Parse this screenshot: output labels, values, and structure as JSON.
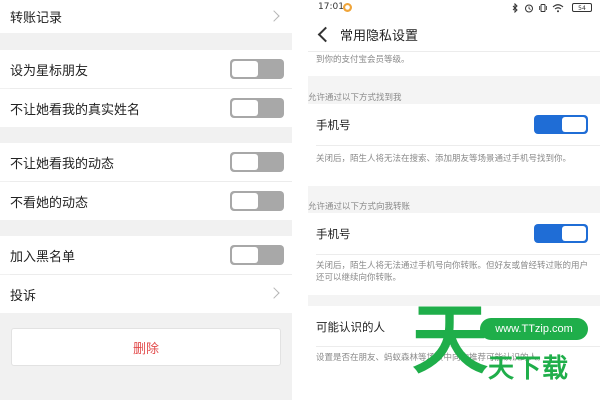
{
  "left": {
    "transfer_record": "转账记录",
    "star_friend": "设为星标朋友",
    "hide_real_name": "不让她看我的真实姓名",
    "hide_my_moments": "不让她看我的动态",
    "hide_her_moments": "不看她的动态",
    "blacklist": "加入黑名单",
    "report": "投诉",
    "delete": "删除",
    "switches": {
      "star_friend": false,
      "hide_real_name": false,
      "hide_my_moments": false,
      "hide_her_moments": false,
      "blacklist": false
    }
  },
  "right": {
    "status": {
      "time": "17:01",
      "battery": "54"
    },
    "title": "常用隐私设置",
    "top_note": "到你的支付宝会员等级。",
    "find_section": "允许通过以下方式找到我",
    "find_phone_label": "手机号",
    "find_phone_note": "关闭后，陌生人将无法在搜索、添加朋友等场景通过手机号找到你。",
    "transfer_section": "允许通过以下方式向我转账",
    "transfer_phone_label": "手机号",
    "transfer_phone_note": "关闭后，陌生人将无法通过手机号向你转账。但好友或曾经转过账的用户还可以继续向你转账。",
    "known_people_label": "可能认识的人",
    "known_people_note": "设置是否在朋友、蚂蚁森林等场景中向你推荐可能认识的人。",
    "switches": {
      "find_phone": true,
      "transfer_phone": true
    }
  },
  "watermark": {
    "big": "天",
    "url": "www.TTzip.com",
    "text": "天下载"
  },
  "colors": {
    "accent_blue": "#1f6dd6",
    "delete_red": "#e24b4b",
    "watermark_green": "#1fae4a"
  }
}
